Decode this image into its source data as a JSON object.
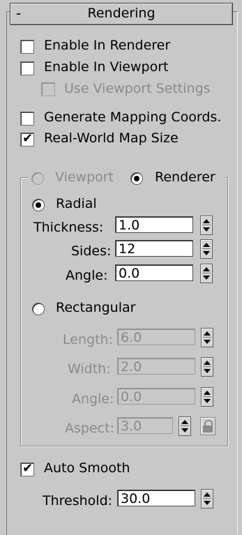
{
  "rollout": {
    "collapse_symbol": "-",
    "title": "Rendering"
  },
  "checkboxes": {
    "enable_renderer": {
      "label": "Enable In Renderer",
      "checked": false
    },
    "enable_viewport": {
      "label": "Enable In Viewport",
      "checked": false
    },
    "use_viewport_settings": {
      "label": "Use Viewport Settings",
      "checked": false,
      "enabled": false
    },
    "generate_mapping": {
      "label": "Generate Mapping Coords.",
      "checked": false
    },
    "real_world_map": {
      "label": "Real-World Map Size",
      "checked": true
    },
    "auto_smooth": {
      "label": "Auto Smooth",
      "checked": true
    }
  },
  "check_mark": "✔",
  "mode_group": {
    "viewport_label": "Viewport",
    "renderer_label": "Renderer",
    "selected": "Renderer"
  },
  "radial": {
    "label": "Radial",
    "selected": true,
    "thickness": {
      "label": "Thickness:",
      "value": "1.0"
    },
    "sides": {
      "label": "Sides:",
      "value": "12"
    },
    "angle": {
      "label": "Angle:",
      "value": "0.0"
    }
  },
  "rectangular": {
    "label": "Rectangular",
    "selected": false,
    "length": {
      "label": "Length:",
      "value": "6.0"
    },
    "width": {
      "label": "Width:",
      "value": "2.0"
    },
    "angle": {
      "label": "Angle:",
      "value": "0.0"
    },
    "aspect": {
      "label": "Aspect:",
      "value": "3.0"
    }
  },
  "threshold": {
    "label": "Threshold:",
    "value": "30.0"
  },
  "icons": {
    "lock": "lock-icon",
    "spinner": "spinner-arrows-icon"
  }
}
